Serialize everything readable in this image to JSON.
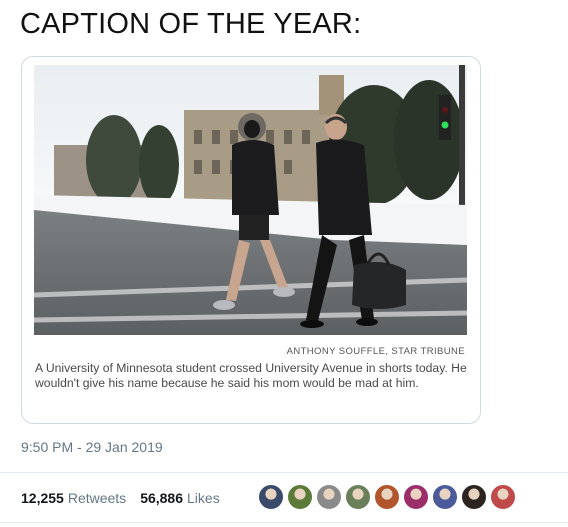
{
  "headline": "CAPTION OF THE YEAR:",
  "card": {
    "credit": "ANTHONY SOUFFLE, STAR TRIBUNE",
    "caption": "A University of Minnesota student crossed University Avenue in shorts today. He wouldn't give his name because he said his mom would be mad at him."
  },
  "timestamp": "9:50 PM - 29 Jan 2019",
  "stats": {
    "retweets_count": "12,255",
    "retweets_label": "Retweets",
    "likes_count": "56,886",
    "likes_label": "Likes"
  },
  "avatars": [
    {
      "name": "avatar-1",
      "color": "#3a4a6b"
    },
    {
      "name": "avatar-2",
      "color": "#5c7a3a"
    },
    {
      "name": "avatar-3",
      "color": "#8a8a8a"
    },
    {
      "name": "avatar-4",
      "color": "#6b7f5a"
    },
    {
      "name": "avatar-5",
      "color": "#b0552c"
    },
    {
      "name": "avatar-6",
      "color": "#9a2d6a"
    },
    {
      "name": "avatar-7",
      "color": "#4a5a9a"
    },
    {
      "name": "avatar-8",
      "color": "#2d2420"
    },
    {
      "name": "avatar-9",
      "color": "#c04a4a"
    }
  ]
}
